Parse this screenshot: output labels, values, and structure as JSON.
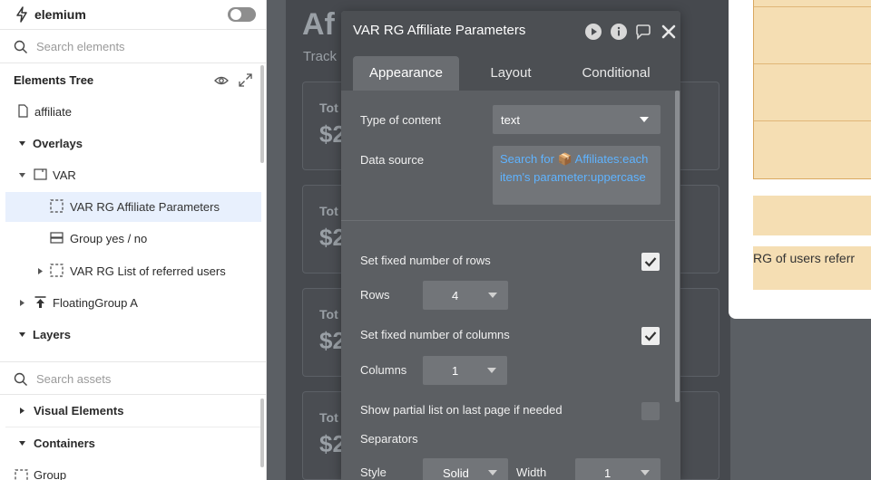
{
  "sidebar": {
    "app_name": "elemium",
    "search_elements_placeholder": "Search elements",
    "elements_tree_title": "Elements Tree",
    "tree": [
      {
        "label": "affiliate"
      },
      {
        "label": "Overlays"
      },
      {
        "label": "VAR"
      },
      {
        "label": "VAR RG Affiliate Parameters"
      },
      {
        "label": "Group yes / no"
      },
      {
        "label": "VAR RG List of referred users"
      },
      {
        "label": "FloatingGroup A"
      },
      {
        "label": "Layers"
      }
    ],
    "search_assets_placeholder": "Search assets",
    "asset_sections": [
      {
        "label": "Visual Elements"
      },
      {
        "label": "Containers"
      },
      {
        "label": "Group"
      }
    ]
  },
  "canvas": {
    "page_title": "Af",
    "page_subtitle": "Track",
    "cards": [
      {
        "t1": "Tot",
        "t2": "$2"
      },
      {
        "t1": "Tot",
        "t2": "$2"
      },
      {
        "t1": "Tot",
        "t2": "$2"
      },
      {
        "t1": "Tot",
        "t2": "$2"
      }
    ],
    "right_label": "RG of users referr"
  },
  "editor": {
    "title": "VAR RG Affiliate Parameters",
    "tabs": [
      {
        "label": "Appearance"
      },
      {
        "label": "Layout"
      },
      {
        "label": "Conditional"
      }
    ],
    "type_of_content_label": "Type of content",
    "type_of_content_value": "text",
    "data_source_label": "Data source",
    "data_source_value": "Search for 📦 Affiliates:each item's parameter:uppercase",
    "fixed_rows_label": "Set fixed number of rows",
    "fixed_rows_checked": true,
    "rows_label": "Rows",
    "rows_value": "4",
    "fixed_cols_label": "Set fixed number of columns",
    "fixed_cols_checked": true,
    "columns_label": "Columns",
    "columns_value": "1",
    "partial_list_label": "Show partial list on last page if needed",
    "partial_list_checked": false,
    "separators_label": "Separators",
    "style_label": "Style",
    "style_value": "Solid",
    "width_label": "Width",
    "width_value": "1"
  },
  "colors": {
    "accent_link": "#5fb3ff",
    "selected_row": "#e8f0fd",
    "tan": "#f5deb3"
  }
}
